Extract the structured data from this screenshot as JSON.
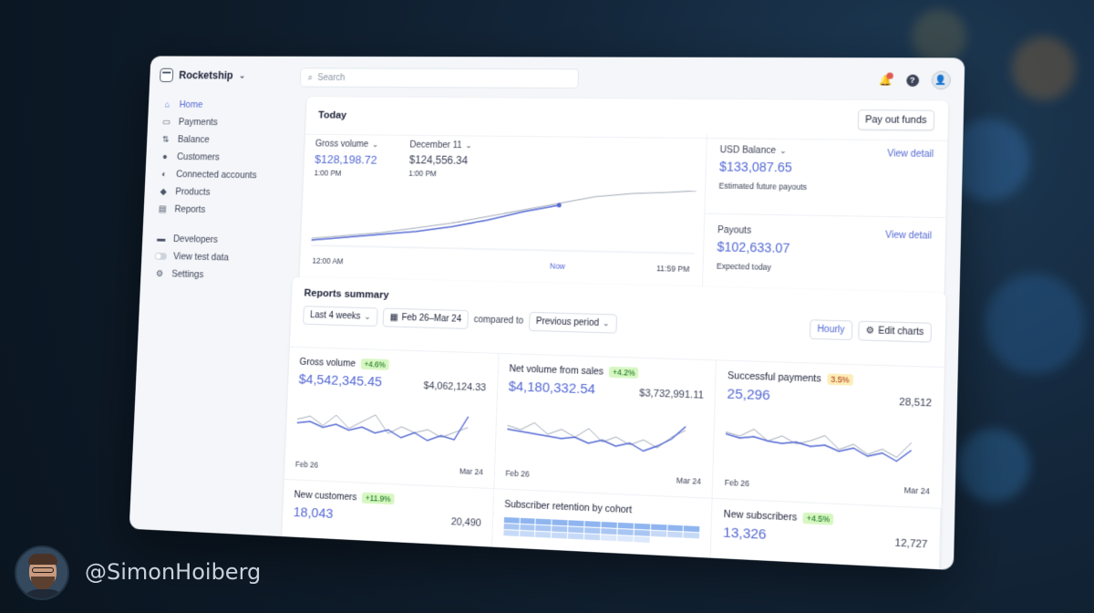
{
  "app": {
    "name": "Rocketship"
  },
  "search": {
    "placeholder": "Search"
  },
  "sidebar": {
    "items": [
      {
        "label": "Home",
        "icon": "home-icon"
      },
      {
        "label": "Payments",
        "icon": "payments-icon"
      },
      {
        "label": "Balance",
        "icon": "balance-icon"
      },
      {
        "label": "Customers",
        "icon": "customers-icon"
      },
      {
        "label": "Connected accounts",
        "icon": "connected-accounts-icon"
      },
      {
        "label": "Products",
        "icon": "products-icon"
      },
      {
        "label": "Reports",
        "icon": "reports-icon"
      }
    ],
    "secondary": [
      {
        "label": "Developers",
        "icon": "developers-icon"
      },
      {
        "label": "View test data",
        "icon": "toggle-icon"
      },
      {
        "label": "Settings",
        "icon": "gear-icon"
      }
    ]
  },
  "today": {
    "title": "Today",
    "payout_button": "Pay out funds",
    "gross_label": "Gross volume",
    "gross_value": "$128,198.72",
    "gross_time": "1:00 PM",
    "compare_label": "December 11",
    "compare_value": "$124,556.34",
    "compare_time": "1:00 PM",
    "axis_start": "12:00 AM",
    "axis_now": "Now",
    "axis_end": "11:59 PM",
    "usd_label": "USD Balance",
    "usd_value": "$133,087.65",
    "usd_sub": "Estimated future payouts",
    "payouts_label": "Payouts",
    "payouts_value": "$102,633.07",
    "payouts_sub": "Expected today",
    "view_detail": "View detail"
  },
  "reports": {
    "title": "Reports summary",
    "range": "Last 4 weeks",
    "dates": "Feb 26–Mar 24",
    "compared_to": "compared to",
    "period": "Previous period",
    "hourly": "Hourly",
    "edit": "Edit charts",
    "cells": [
      {
        "title": "Gross volume",
        "chip": "+4.6%",
        "main": "$4,542,345.45",
        "cmp": "$4,062,124.33",
        "start": "Feb 26",
        "end": "Mar 24"
      },
      {
        "title": "Net volume from sales",
        "chip": "+4.2%",
        "main": "$4,180,332.54",
        "cmp": "$3,732,991.11",
        "start": "Feb 26",
        "end": "Mar 24"
      },
      {
        "title": "Successful payments",
        "chip": "3.5%",
        "main": "25,296",
        "cmp": "28,512",
        "start": "Feb 26",
        "end": "Mar 24"
      },
      {
        "title": "New customers",
        "chip": "+11.9%",
        "main": "18,043",
        "cmp": "20,490"
      },
      {
        "title": "Subscriber retention by cohort"
      },
      {
        "title": "New subscribers",
        "chip": "+4.5%",
        "main": "13,326",
        "cmp": "12,727"
      }
    ]
  },
  "footer": {
    "handle": "@SimonHoiberg"
  },
  "colors": {
    "accent": "#5469d4",
    "positive_bg": "#d7f7c2",
    "warn_bg": "#fcedb9"
  }
}
